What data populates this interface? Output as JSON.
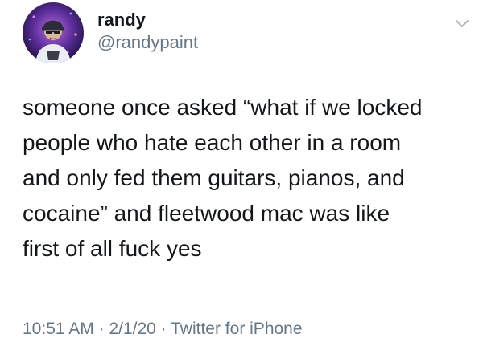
{
  "author": {
    "display_name": "randy",
    "handle": "@randypaint",
    "avatar_icon": "profile-avatar"
  },
  "tweet": {
    "lines": [
      "someone once asked “what if we locked",
      "people who hate each other in a room",
      "and only fed them guitars, pianos, and",
      "cocaine” and fleetwood mac was like",
      "first of all fuck yes"
    ]
  },
  "meta": {
    "time": "10:51 AM",
    "separator_1": "·",
    "date": "2/1/20",
    "separator_2": "·",
    "source": "Twitter for iPhone"
  },
  "menu": {
    "icon": "chevron-down-icon"
  },
  "colors": {
    "text": "#14171a",
    "secondary": "#657786",
    "background": "#ffffff"
  }
}
